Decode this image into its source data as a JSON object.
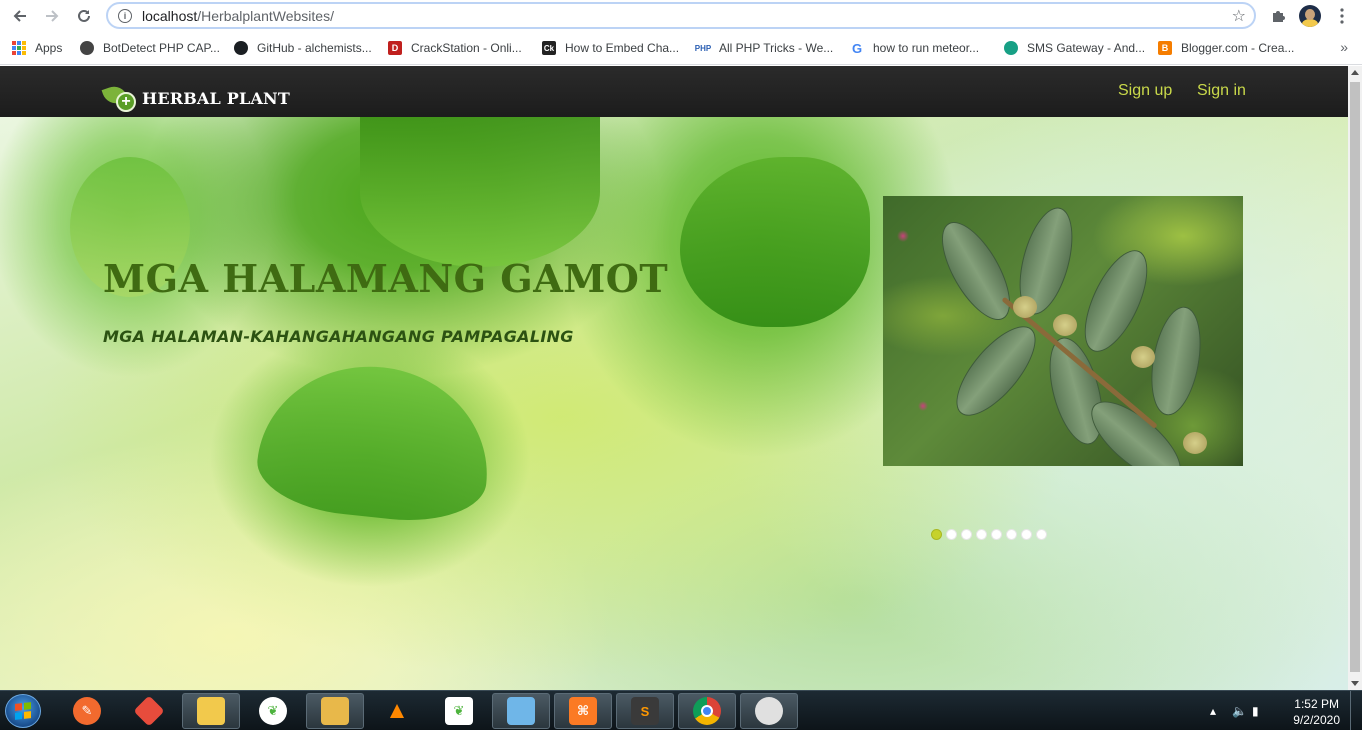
{
  "browser": {
    "url_host": "localhost",
    "url_path": "/HerbalplantWebsites/",
    "bookmarks": [
      {
        "label": "Apps",
        "icon": "apps-grid-icon"
      },
      {
        "label": "BotDetect PHP CAP...",
        "icon": "globe-icon",
        "color": "#444444"
      },
      {
        "label": "GitHub - alchemists...",
        "icon": "github-icon",
        "color": "#1b1f23"
      },
      {
        "label": "CrackStation - Onli...",
        "icon": "crackstation-icon",
        "color": "#c0201e"
      },
      {
        "label": "How to Embed Cha...",
        "icon": "ck-icon",
        "color": "#222222"
      },
      {
        "label": "All PHP Tricks - We...",
        "icon": "php-icon",
        "color": "#2b5fb3"
      },
      {
        "label": "how to run meteor...",
        "icon": "google-icon",
        "color": "#4285f4"
      },
      {
        "label": "SMS Gateway - And...",
        "icon": "sms-icon",
        "color": "#17a085"
      },
      {
        "label": "Blogger.com - Crea...",
        "icon": "blogger-icon",
        "color": "#f57d00"
      }
    ]
  },
  "site": {
    "logo_text": "HERBAL PLANT",
    "nav": {
      "signup": "Sign up",
      "signin": "Sign in"
    },
    "nav_color": "#c9d94a",
    "hero": {
      "title": "MGA HALAMANG GAMOT",
      "subtitle": "MGA HALAMAN-KAHANGAHANGANG PAMPAGALING"
    },
    "carousel": {
      "slide_count": 8,
      "active_index": 0,
      "active_color": "#c6d22b"
    }
  },
  "taskbar": {
    "apps": [
      {
        "name": "brackets-icon",
        "color": "#f26a2e"
      },
      {
        "name": "git-icon",
        "color": "#e74c3c"
      },
      {
        "name": "file-explorer-window-icon",
        "color": "#f2c94c"
      },
      {
        "name": "mongodb-compass-icon",
        "color": "#4db33d"
      },
      {
        "name": "file-explorer-icon",
        "color": "#e8b84a"
      },
      {
        "name": "vlc-icon",
        "color": "#ff8800"
      },
      {
        "name": "mongodb-icon",
        "color": "#4db33d"
      },
      {
        "name": "notepad-icon",
        "color": "#6fb6e8"
      },
      {
        "name": "xampp-icon",
        "color": "#fb7a24"
      },
      {
        "name": "sublime-text-icon",
        "color": "#ff9800"
      },
      {
        "name": "chrome-icon",
        "color": "#4285f4"
      },
      {
        "name": "paint-icon",
        "color": "#e0e0e0"
      }
    ],
    "time": "1:52 PM",
    "date": "9/2/2020"
  }
}
